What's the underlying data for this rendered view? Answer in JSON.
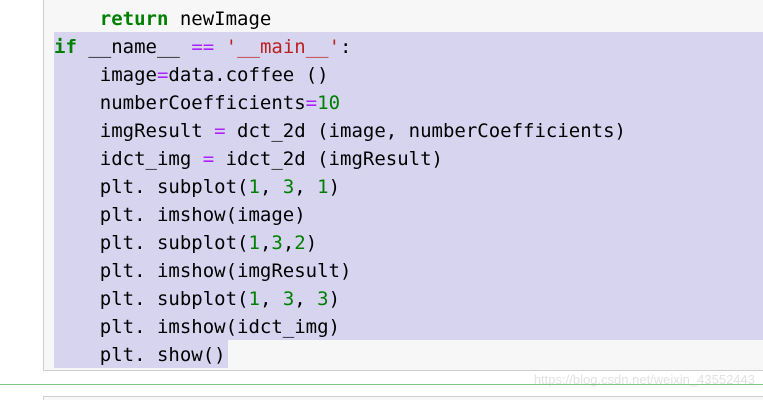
{
  "code": {
    "line_0": {
      "indent": "    ",
      "kw": "return",
      "rest": " newImage"
    },
    "line_1": {
      "kw": "if",
      "sp": " ",
      "name": "__name__",
      "sp2": " ",
      "op": "==",
      "sp3": " ",
      "str": "'__main__'",
      "colon": ":"
    },
    "line_2": {
      "indent": "    ",
      "a": "image",
      "op": "=",
      "b": "data.coffee ()"
    },
    "line_3": {
      "indent": "    ",
      "a": "numberCoefficients",
      "op": "=",
      "num": "10"
    },
    "line_4": {
      "indent": "    ",
      "a": "imgResult ",
      "op": "=",
      "b": " dct_2d (image, numberCoefficients)"
    },
    "line_5": {
      "indent": "    ",
      "a": "idct_img ",
      "op": "=",
      "b": " idct_2d (imgResult)"
    },
    "line_6": {
      "indent": "    ",
      "a": "plt. subplot(",
      "n1": "1",
      "c1": ", ",
      "n2": "3",
      "c2": ", ",
      "n3": "1",
      "end": ")"
    },
    "line_7": {
      "indent": "    ",
      "a": "plt. imshow(image)"
    },
    "line_8": {
      "indent": "    ",
      "a": "plt. subplot(",
      "n1": "1",
      "c1": ",",
      "n2": "3",
      "c2": ",",
      "n3": "2",
      "end": ")"
    },
    "line_9": {
      "indent": "    ",
      "a": "plt. imshow(imgResult)"
    },
    "line_10": {
      "indent": "    ",
      "a": "plt. subplot(",
      "n1": "1",
      "c1": ", ",
      "n2": "3",
      "c2": ", ",
      "n3": "3",
      "end": ")"
    },
    "line_11": {
      "indent": "    ",
      "a": "plt. imshow(idct_img)"
    },
    "line_12": {
      "indent": "    ",
      "a": "plt. show()"
    }
  },
  "watermark": "https://blog.csdn.net/weixin_43552443",
  "colors": {
    "selection": "#d6d4ef",
    "keyword": "#008000",
    "operator": "#aa22ff",
    "string": "#ba2121",
    "number": "#008000",
    "cell_background": "#f7f7f7",
    "separator": "#7cc57c"
  }
}
